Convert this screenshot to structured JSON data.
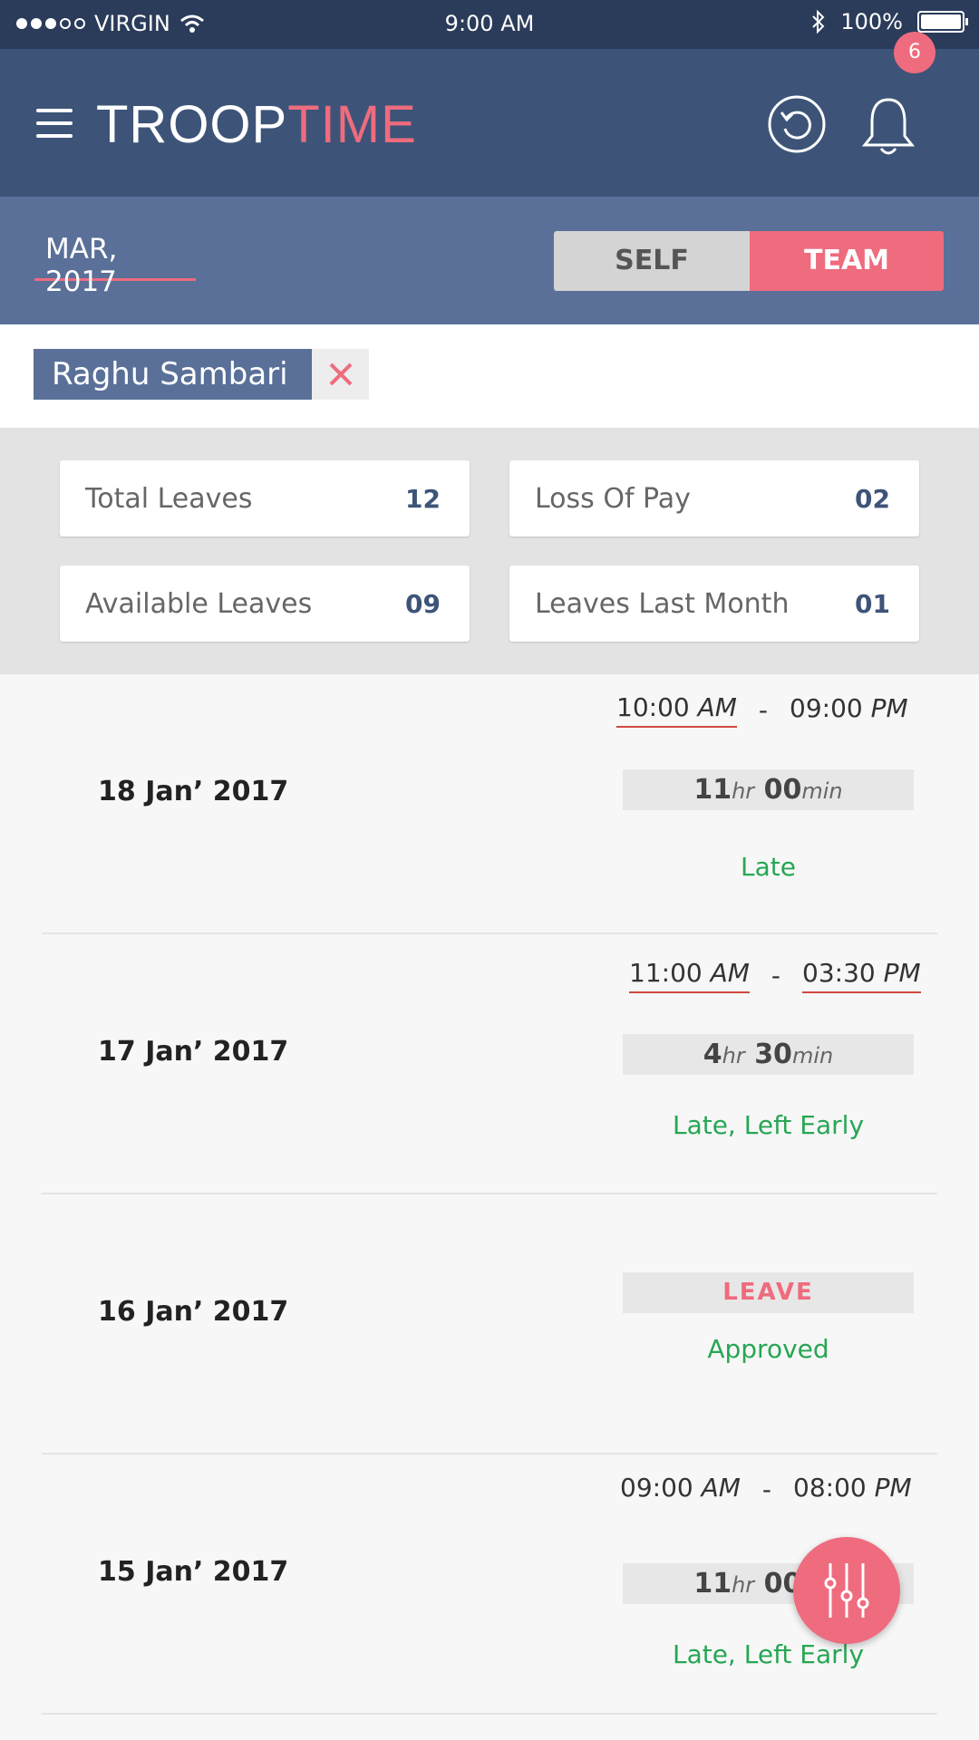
{
  "status_bar": {
    "carrier": "VIRGIN",
    "time": "9:00 AM",
    "battery": "100%"
  },
  "header": {
    "logo_primary": "TROOP",
    "logo_secondary": "TIME",
    "notification_count": "6"
  },
  "filter": {
    "month": "MAR, 2017",
    "self_label": "SELF",
    "team_label": "TEAM",
    "selected": "TEAM"
  },
  "chip": {
    "name": "Raghu Sambari"
  },
  "stats": [
    {
      "label": "Total Leaves",
      "value": "12"
    },
    {
      "label": "Loss Of Pay",
      "value": "02"
    },
    {
      "label": "Available Leaves",
      "value": "09"
    },
    {
      "label": "Leaves Last Month",
      "value": "01"
    }
  ],
  "entries": [
    {
      "date": "18 Jan’ 2017",
      "start": "10:00",
      "start_period": "AM",
      "end": "09:00",
      "end_period": "PM",
      "hours": "11",
      "hr_unit": "hr",
      "minutes": "00",
      "min_unit": "min",
      "status": "Late"
    },
    {
      "date": "17 Jan’ 2017",
      "start": "11:00",
      "start_period": "AM",
      "end": "03:30",
      "end_period": "PM",
      "hours": "4",
      "hr_unit": "hr",
      "minutes": "30",
      "min_unit": "min",
      "status": "Late, Left Early"
    },
    {
      "date": "16 Jan’ 2017",
      "leave_label": "LEAVE",
      "status": "Approved"
    },
    {
      "date": "15 Jan’ 2017",
      "start": "09:00",
      "start_period": "AM",
      "end": "08:00",
      "end_period": "PM",
      "hours": "11",
      "hr_unit": "hr",
      "minutes": "00",
      "min_unit": "min",
      "status": "Late, Left Early"
    }
  ],
  "colors": {
    "header": "#3d5478",
    "filter_bar": "#5a7099",
    "accent": "#ef6b7e",
    "status_green": "#27a653"
  }
}
